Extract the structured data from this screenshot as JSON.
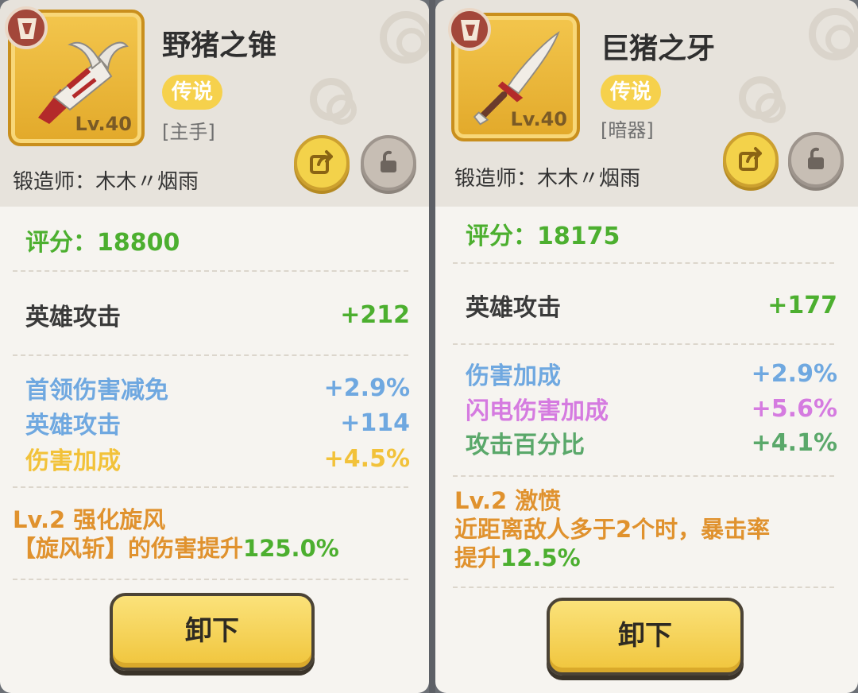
{
  "items": [
    {
      "name": "野猪之锥",
      "level": "Lv.40",
      "rarity": "传说",
      "slot": "[主手]",
      "smith_label": "锻造师：",
      "smith_name": "木木〃烟雨",
      "score_label": "评分：",
      "score_value": "18800",
      "main_stat": {
        "name": "英雄攻击",
        "value": "+212"
      },
      "sub_stats": [
        {
          "name": "首领伤害减免",
          "value": "+2.9%",
          "color": "#6fa8e0"
        },
        {
          "name": "英雄攻击",
          "value": "+114",
          "color": "#6fa8e0"
        },
        {
          "name": "伤害加成",
          "value": "+4.5%",
          "color": "#f2c23a"
        }
      ],
      "skill_title": "Lv.2 强化旋风",
      "skill_desc": "【旋风斩】的伤害提升",
      "skill_value": "125.0%",
      "button_label": "卸下"
    },
    {
      "name": "巨猪之牙",
      "level": "Lv.40",
      "rarity": "传说",
      "slot": "[暗器]",
      "smith_label": "锻造师：",
      "smith_name": "木木〃烟雨",
      "score_label": "评分：",
      "score_value": "18175",
      "main_stat": {
        "name": "英雄攻击",
        "value": "+177"
      },
      "sub_stats": [
        {
          "name": "伤害加成",
          "value": "+2.9%",
          "color": "#6fa8e0"
        },
        {
          "name": "闪电伤害加成",
          "value": "+5.6%",
          "color": "#d57be0"
        },
        {
          "name": "攻击百分比",
          "value": "+4.1%",
          "color": "#5aa86a"
        }
      ],
      "skill_title": "Lv.2 激愤",
      "skill_desc_line1": "近距离敌人多于2个时，暴击率",
      "skill_desc_line2": "提升",
      "skill_value": "12.5%",
      "button_label": "卸下"
    }
  ],
  "icons": {
    "share": "share-icon",
    "lock": "unlock-icon",
    "rank": "rank-emblem-icon"
  },
  "colors": {
    "gold_frame": "#f3c64d",
    "rarity": "#f6d14c",
    "score_green": "#4caf2f",
    "skill_orange": "#e0922e"
  }
}
